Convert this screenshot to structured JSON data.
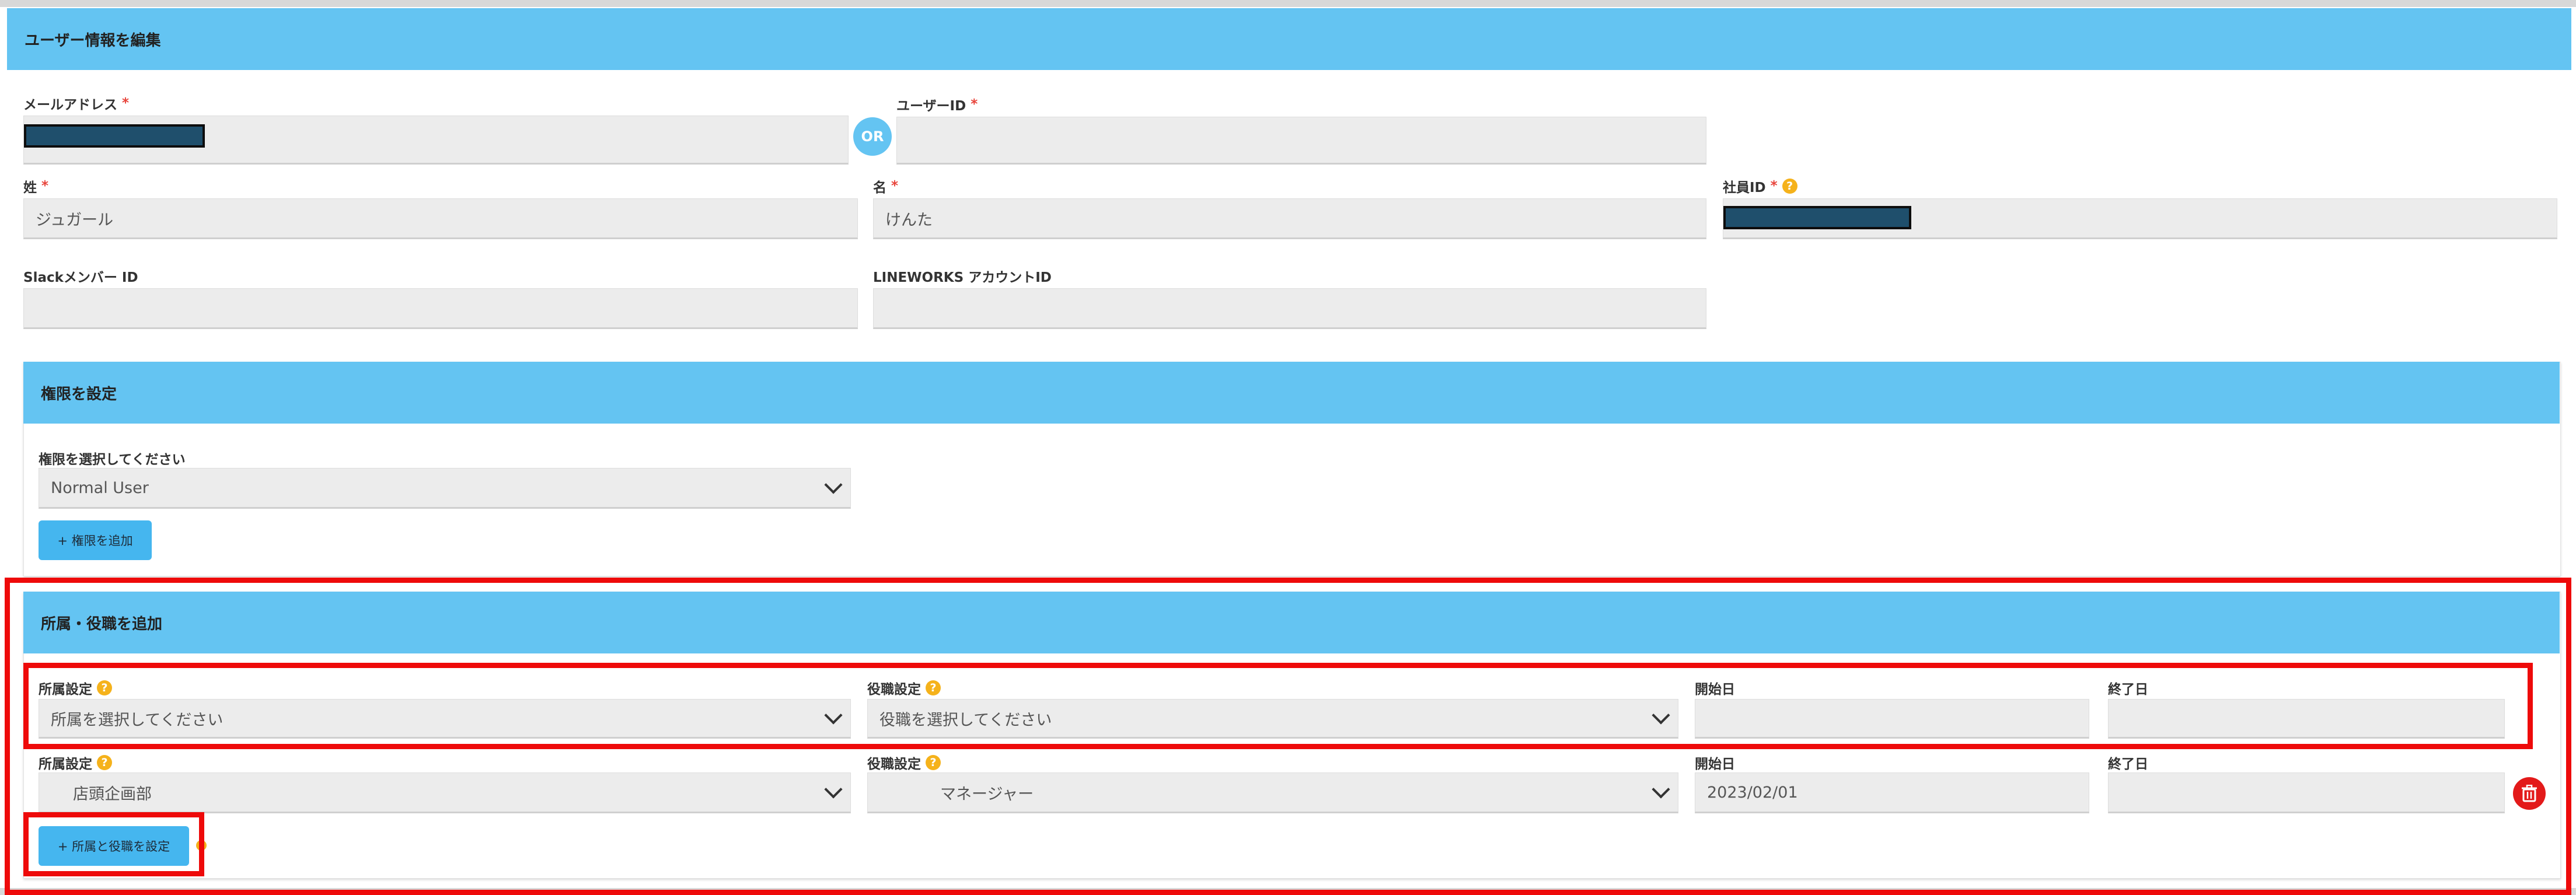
{
  "edit_user": {
    "header": "ユーザー情報を編集",
    "email_label": "メールアドレス",
    "or_label": "OR",
    "user_id_label": "ユーザーID",
    "last_name_label": "姓",
    "last_name_value": "ジュガール",
    "first_name_label": "名",
    "first_name_value": "けんた",
    "employee_id_label": "社員ID",
    "slack_label": "Slackメンバー ID",
    "lineworks_label": "LINEWORKS アカウントID",
    "required_mark": "*"
  },
  "permissions": {
    "header": "権限を設定",
    "select_label": "権限を選択してください",
    "select_value": "Normal User",
    "add_button": "+ 権限を追加"
  },
  "affiliation": {
    "header": "所属・役職を追加",
    "dept_label": "所属設定",
    "role_label": "役職設定",
    "start_label": "開始日",
    "end_label": "終了日",
    "rows": [
      {
        "dept": "所属を選択してください",
        "role": "役職を選択してください",
        "start": "",
        "end": ""
      },
      {
        "dept": "店頭企画部",
        "role": "マネージャー",
        "start": "2023/02/01",
        "end": ""
      }
    ],
    "set_button": "+ 所属と役職を設定"
  },
  "colors": {
    "header_bg": "#64c4f2",
    "highlight": "#ee0a0a",
    "required": "#e8453c",
    "help": "#f5b21b",
    "danger": "#e31a1a"
  }
}
